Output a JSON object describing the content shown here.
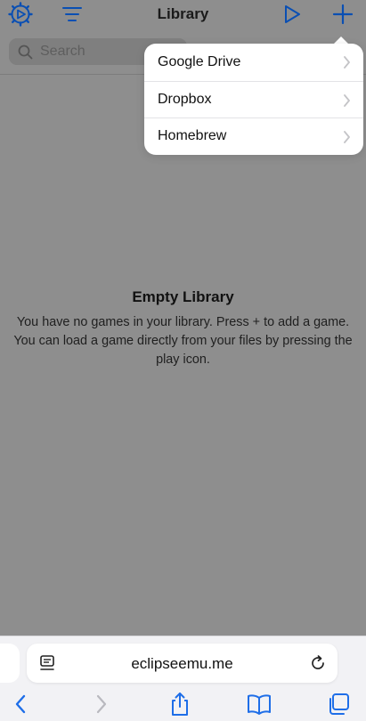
{
  "navbar": {
    "title": "Library",
    "icons": [
      "settings-icon",
      "sort-list-icon",
      "play-icon",
      "plus-icon"
    ]
  },
  "search": {
    "placeholder": "Search"
  },
  "menu": {
    "items": [
      {
        "label": "Google Drive"
      },
      {
        "label": "Dropbox"
      },
      {
        "label": "Homebrew"
      }
    ]
  },
  "empty_state": {
    "title": "Empty Library",
    "message": "You have no games in your library. Press + to add a game. You can load a game directly from your files by pressing the play icon."
  },
  "browser": {
    "url": "eclipseemu.me"
  },
  "colors": {
    "accent": "#0a4fb3",
    "dim_background": "#8e8e8e",
    "safari_blue": "#1e6ee8"
  }
}
